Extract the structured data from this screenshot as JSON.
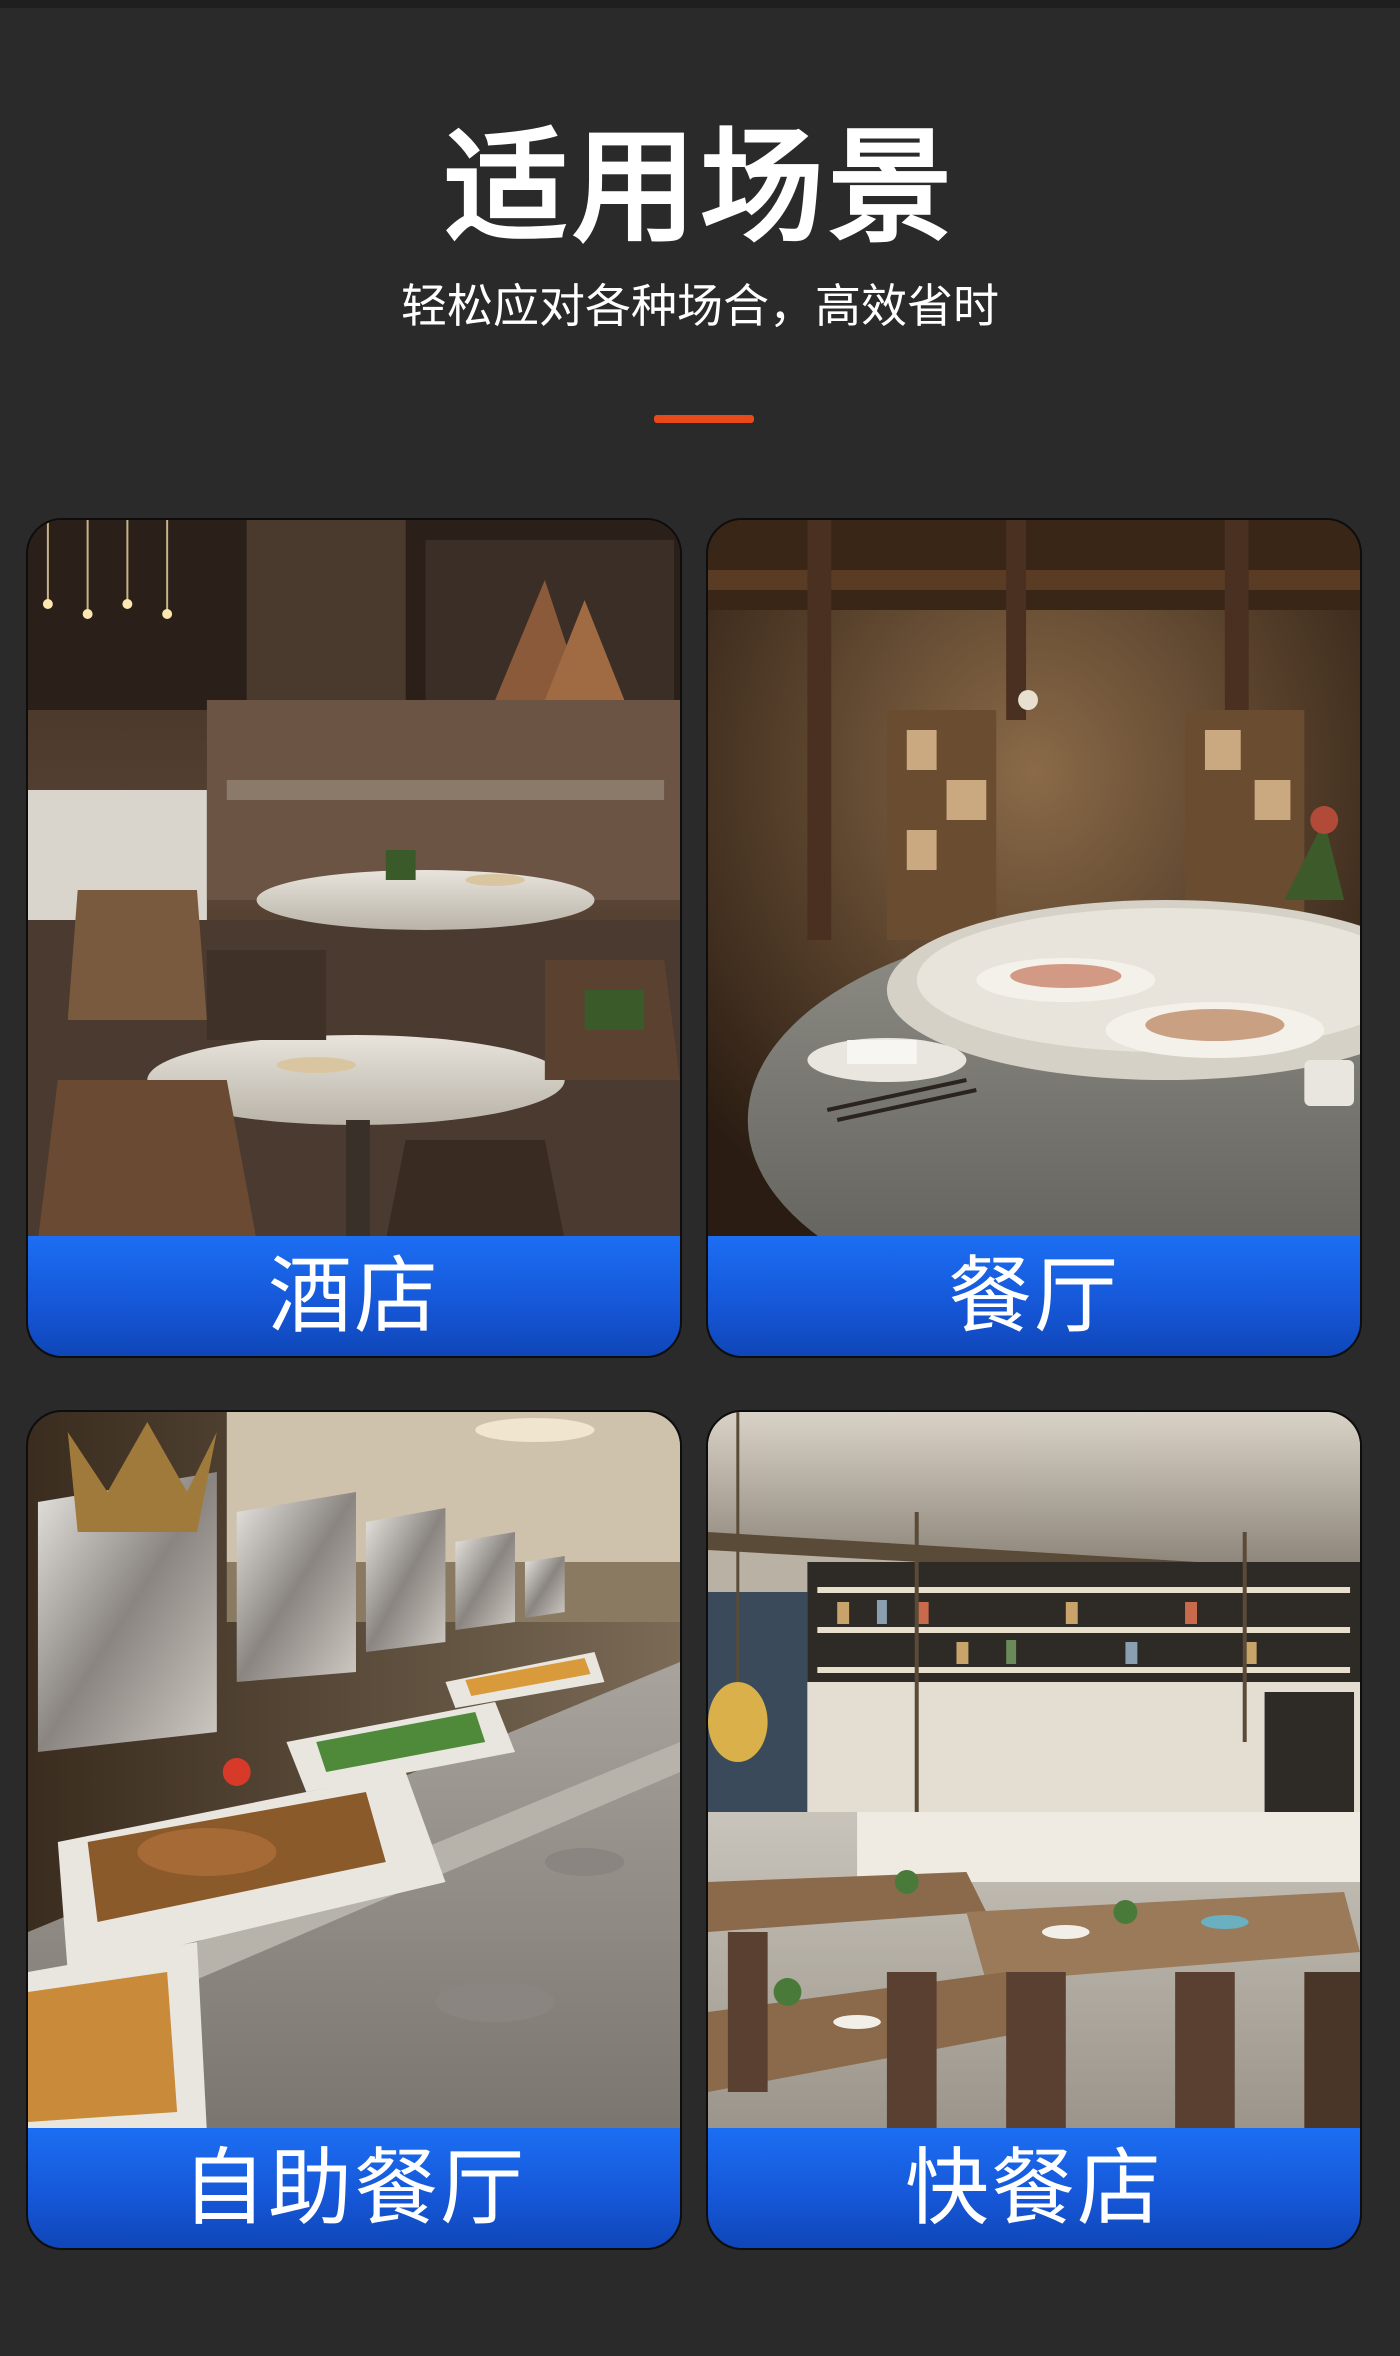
{
  "header": {
    "title": "适用场景",
    "subtitle": "轻松应对各种场合，高效省时",
    "accent_color": "#e84a1a"
  },
  "cards": [
    {
      "label": "酒店",
      "photo": "hotel-dining-room-photo"
    },
    {
      "label": "餐厅",
      "photo": "restaurant-round-table-photo"
    },
    {
      "label": "自助餐厅",
      "photo": "buffet-chafing-dishes-photo"
    },
    {
      "label": "快餐店",
      "photo": "fast-food-dining-hall-photo"
    }
  ],
  "colors": {
    "background": "#2a2a2b",
    "label_blue": "#1556d6",
    "text": "#ffffff"
  }
}
